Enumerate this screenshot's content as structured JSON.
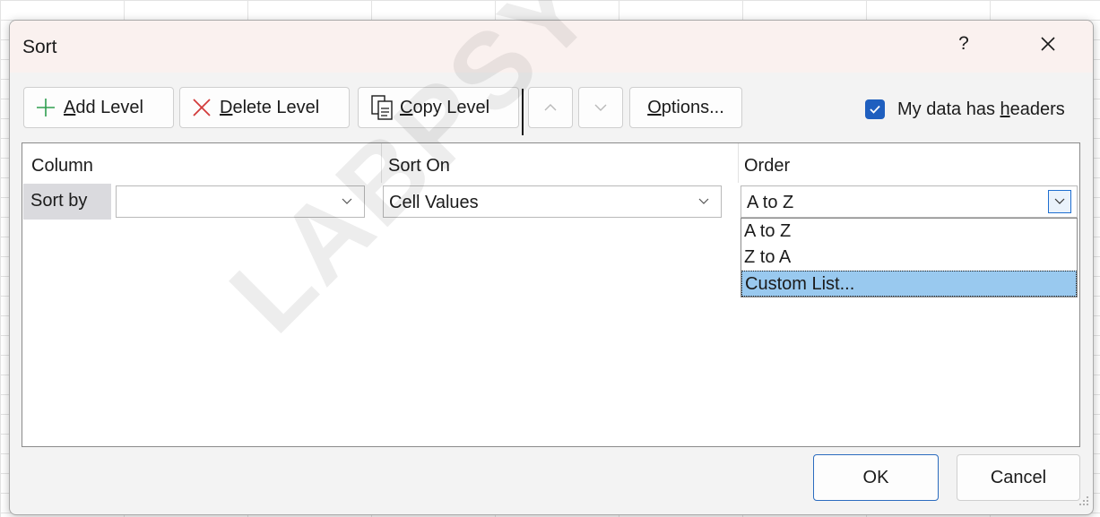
{
  "dialog": {
    "title": "Sort",
    "help_label": "?"
  },
  "toolbar": {
    "add_level": {
      "prefix": "",
      "accel": "A",
      "rest": "dd Level"
    },
    "delete_level": {
      "accel": "D",
      "rest": "elete Level"
    },
    "copy_level": {
      "accel": "C",
      "rest": "opy Level"
    },
    "options": {
      "accel": "O",
      "rest": "ptions..."
    },
    "headers_checkbox": {
      "checked": true,
      "label_before": "My data has ",
      "accel": "h",
      "label_after": "eaders"
    }
  },
  "grid": {
    "headers": {
      "column": "Column",
      "sort_on": "Sort On",
      "order": "Order"
    },
    "row": {
      "label": "Sort by",
      "column_value": "",
      "sort_on_value": "Cell Values",
      "order_value": "A to Z"
    },
    "order_dropdown": {
      "options": [
        "A to Z",
        "Z to A",
        "Custom List..."
      ],
      "highlighted": "Custom List..."
    }
  },
  "footer": {
    "ok": "OK",
    "cancel": "Cancel"
  },
  "watermark": "LABPSYCHOLOG",
  "colors": {
    "accent": "#1f5fbf",
    "highlight": "#99c9ef",
    "title_bg": "#faf1ef",
    "add_icon": "#2e9e4f",
    "delete_icon": "#d23c3c"
  },
  "icons": [
    "plus-icon",
    "x-icon",
    "copy-icon",
    "chevron-up-icon",
    "chevron-down-icon",
    "close-icon",
    "check-icon",
    "resize-grip-icon"
  ]
}
